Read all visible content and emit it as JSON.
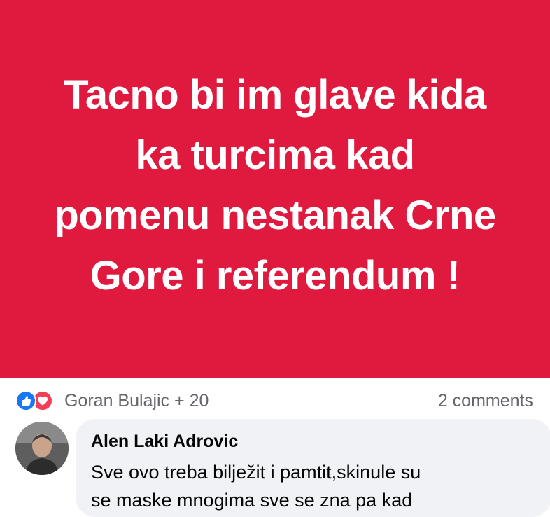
{
  "post": {
    "text": "Tacno bi im glave kida ka turcima kad pomenu nestanak Crne Gore i referendum !",
    "lines": [
      "Tacno bi im glave kida",
      "ka turcima kad",
      "pomenu nestanak Crne",
      "Gore i referendum !"
    ],
    "background_color": "#e01a3f"
  },
  "reactions": {
    "icons": [
      "like-icon",
      "love-icon"
    ],
    "names": "Goran Bulajic + 20",
    "comment_count": "2 comments"
  },
  "comment": {
    "author": "Alen Laki Adrovic",
    "text_lines": [
      "Sve ovo treba bilježit i pamtit,skinule su",
      "se maske mnogima sve se zna pa kad"
    ]
  },
  "colors": {
    "like_blue": "#1877f2",
    "love_red": "#f33e58",
    "secondary_text": "#65676b",
    "bubble_bg": "#f0f2f5"
  }
}
